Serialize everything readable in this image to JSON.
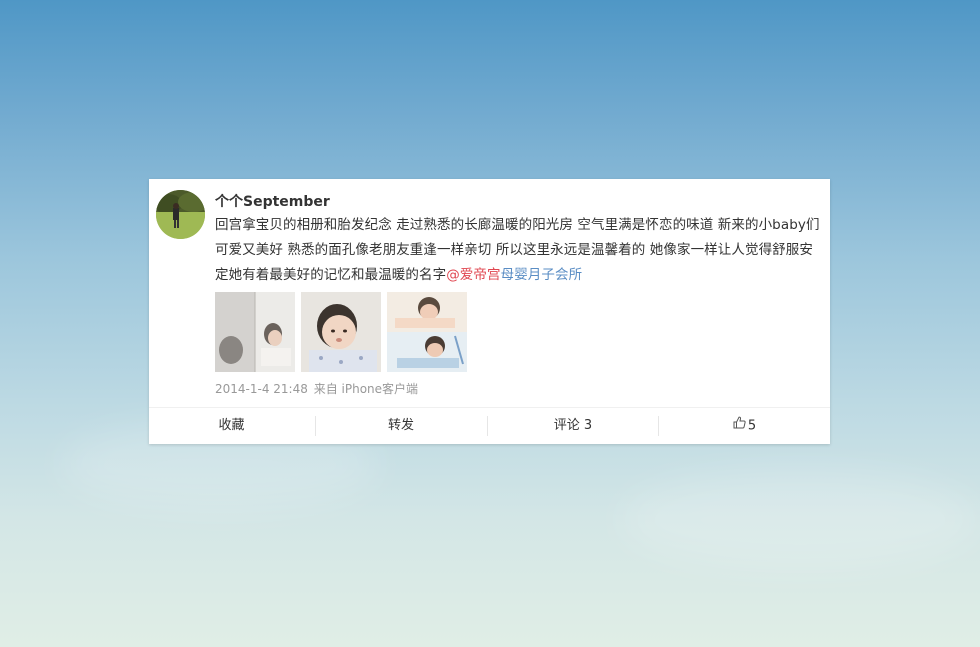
{
  "post": {
    "username": "个个September",
    "text": "回宫拿宝贝的相册和胎发纪念 走过熟悉的长廊温暖的阳光房 空气里满是怀恋的味道 新来的小baby们可爱又美好 熟悉的面孔像老朋友重逢一样亲切 所以这里永远是温馨着的 她像家一样让人觉得舒服安定她有着最美好的记忆和最温暖的名字",
    "mention_primary": "@爱帝宫",
    "mention_secondary": "母婴月子会所",
    "timestamp": "2014-1-4 21:48",
    "source": "来自 iPhone客户端"
  },
  "actions": {
    "favorite_label": "收藏",
    "repost_label": "转发",
    "comment_label": "评论 3",
    "like_count": "5"
  },
  "colors": {
    "mention_primary": "#e0454f",
    "mention_secondary": "#5a8dc4",
    "meta_text": "#999999"
  },
  "icons": {
    "like": "thumbs-up-icon"
  }
}
